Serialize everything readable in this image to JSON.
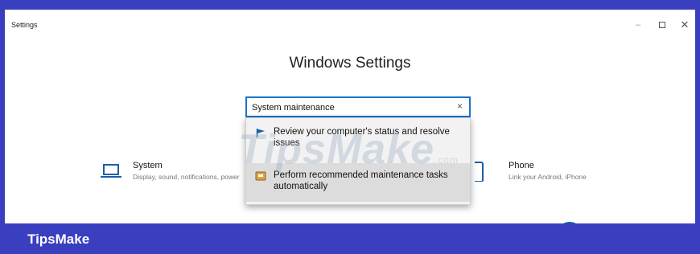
{
  "window": {
    "title": "Settings",
    "minimize_glyph": "–",
    "close_glyph": "✕"
  },
  "heading": "Windows Settings",
  "search": {
    "value": "System maintenance",
    "clear_glyph": "×"
  },
  "suggestions": [
    {
      "label": "Review your computer's status and resolve issues",
      "icon": "flag-icon"
    },
    {
      "label": "Perform recommended maintenance tasks automatically",
      "icon": "maintenance-icon"
    }
  ],
  "categories": {
    "system": {
      "title": "System",
      "desc": "Display, sound, notifications, power",
      "icon": "laptop-icon"
    },
    "phone": {
      "title": "Phone",
      "desc": "Link your Android, iPhone",
      "icon": "phone-icon"
    }
  },
  "watermark": {
    "text": "TipsMake",
    "suffix": ".com"
  },
  "footer": {
    "brand": "TipsMake"
  },
  "colors": {
    "accent": "#1a73c9",
    "banner": "#3a3fbf"
  }
}
